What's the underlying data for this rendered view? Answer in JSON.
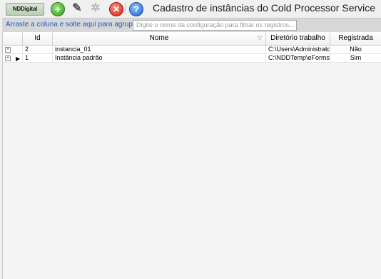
{
  "toolbar": {
    "logo_text": "NDDigital",
    "title": "Cadastro de instâncias do Cold Processor Service",
    "buttons": [
      {
        "name": "add",
        "glyph": "+"
      },
      {
        "name": "edit",
        "glyph": "✎"
      },
      {
        "name": "settings",
        "glyph": "✲"
      },
      {
        "name": "delete",
        "glyph": "✕"
      },
      {
        "name": "help",
        "glyph": "?"
      }
    ]
  },
  "group_bar": {
    "hint": "Arraste a coluna e solte aqui para agrupar",
    "filter_placeholder": "Digite o nome da configuração para filtrar os registros..."
  },
  "grid": {
    "columns": [
      "Id",
      "Nome",
      "Diretório trabalho",
      "Registrada"
    ],
    "rows": [
      {
        "id": "2",
        "nome": "instancia_01",
        "diretorio": "C:\\Users\\Administrator...",
        "registrada": "Não",
        "expander": "+",
        "indicator": ""
      },
      {
        "id": "1",
        "nome": "Instância padrão",
        "diretorio": "C:\\NDDTemp\\eForms_...",
        "registrada": "Sim",
        "expander": "+",
        "indicator": "▶"
      }
    ]
  }
}
